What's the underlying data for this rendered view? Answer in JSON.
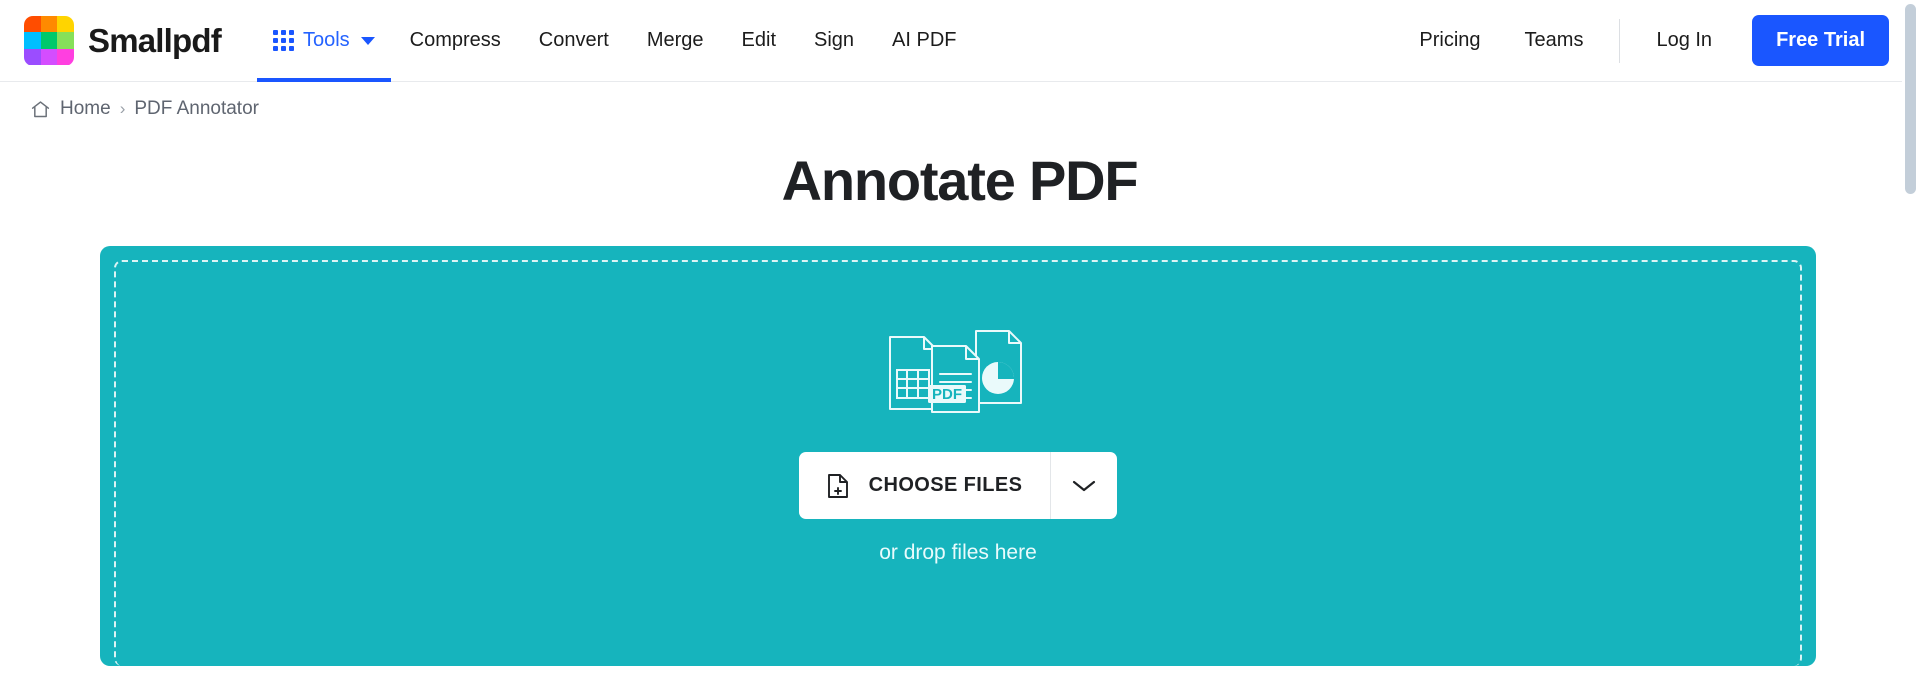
{
  "brand": {
    "name": "Smallpdf",
    "logo_colors": [
      "#ff4d00",
      "#ff8a00",
      "#ffd400",
      "#00bfff",
      "#00c96b",
      "#86e05a",
      "#9b4dff",
      "#d44dff",
      "#ff3fe0"
    ]
  },
  "nav": {
    "tools": {
      "label": "Tools",
      "icon": "grid-dots-icon",
      "caret": "chevron-down-icon",
      "active": true,
      "color": "#1a56ff"
    },
    "items": [
      {
        "label": "Compress"
      },
      {
        "label": "Convert"
      },
      {
        "label": "Merge"
      },
      {
        "label": "Edit"
      },
      {
        "label": "Sign"
      },
      {
        "label": "AI PDF"
      }
    ],
    "right_items": [
      {
        "label": "Pricing"
      },
      {
        "label": "Teams"
      }
    ],
    "login_label": "Log In",
    "trial_label": "Free Trial",
    "trial_color": "#1a56ff"
  },
  "breadcrumb": {
    "home_icon": "home-icon",
    "home_label": "Home",
    "separator": "›",
    "current_label": "PDF Annotator"
  },
  "page": {
    "title": "Annotate PDF"
  },
  "dropzone": {
    "background_color": "#16b4bd",
    "illustration": "documents-stack-icon",
    "pdf_badge": "PDF",
    "choose_files_label": "CHOOSE FILES",
    "choose_files_icon": "file-plus-icon",
    "dropdown_icon": "chevron-down-icon",
    "drop_hint": "or drop files here"
  }
}
